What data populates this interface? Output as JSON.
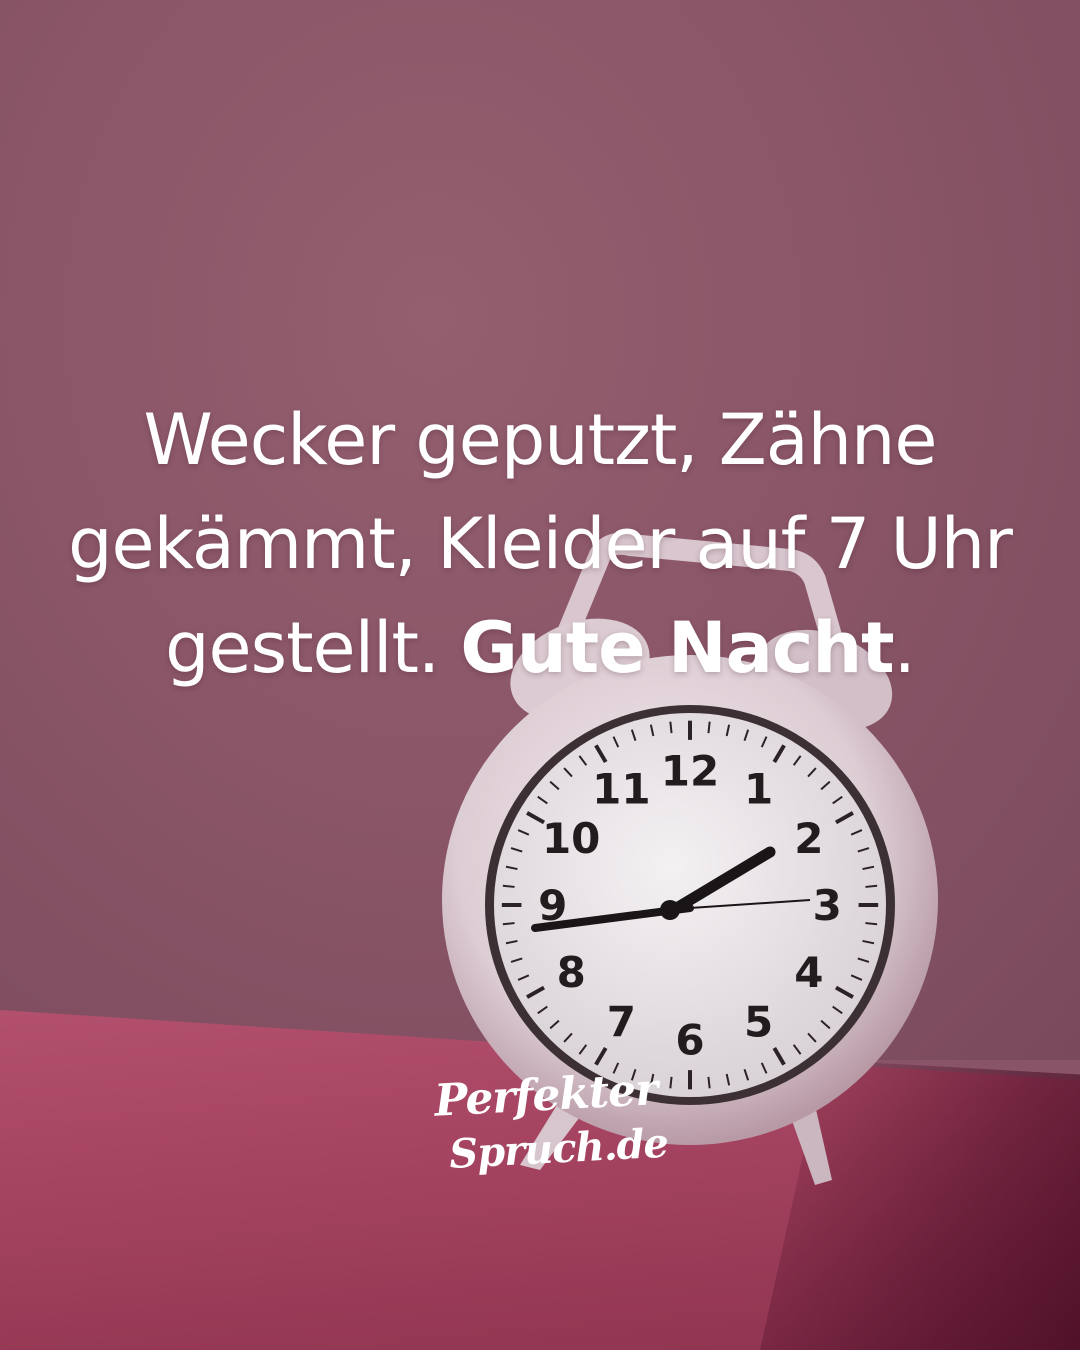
{
  "quote": {
    "line1": "Wecker geputzt, Zähne",
    "line2": "gekämmt, Kleider auf 7 Uhr",
    "line3_regular": "gestellt. ",
    "line3_bold": "Gute Nacht",
    "line3_end": "."
  },
  "brand": {
    "line1": "Perfekter",
    "line2": "Spruch.de"
  },
  "clock": {
    "numerals": [
      "12",
      "1",
      "2",
      "3",
      "4",
      "5",
      "6",
      "7",
      "8",
      "9",
      "10",
      "11"
    ],
    "time_shown": "2:45"
  },
  "colors": {
    "wall": "#8a5668",
    "floor": "#a4435f",
    "clock_body": "#ece2e6",
    "text": "#ffffff"
  }
}
